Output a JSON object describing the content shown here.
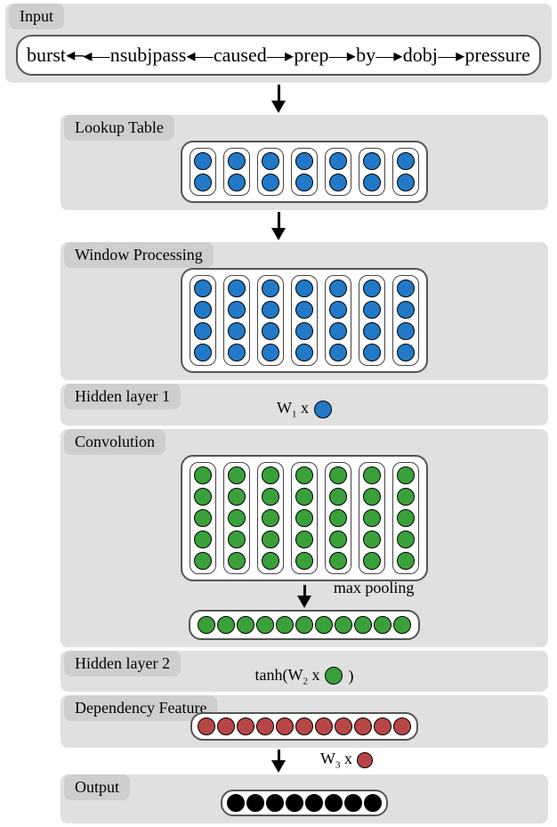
{
  "sections": {
    "input": "Input",
    "lookup": "Lookup Table",
    "window": "Window Processing",
    "hidden1": "Hidden layer 1",
    "conv": "Convolution",
    "hidden2": "Hidden layer 2",
    "depfeat": "Dependency Feature",
    "output": "Output"
  },
  "tokens": [
    "burst",
    "nsubjpass",
    "caused",
    "prep",
    "by",
    "dobj",
    "pressure"
  ],
  "formulas": {
    "hidden1": "W1 x",
    "maxpool": "max pooling",
    "hidden2": "tanh(W2 x",
    "hidden2_close": ")",
    "hidden3": "W3 x"
  },
  "layout": {
    "lookup_cols": 7,
    "lookup_rows": 2,
    "window_cols": 7,
    "window_rows": 4,
    "conv_cols": 7,
    "conv_rows": 5,
    "pooled_len": 11,
    "dep_len": 11,
    "out_len": 8
  },
  "colors": {
    "blue": "#2179c7",
    "green": "#3aa13a",
    "red": "#b84646",
    "black": "#000000",
    "section_bg": "#e0e0e0",
    "label_bg": "#cecece"
  },
  "chart_data": {
    "type": "other",
    "description": "Neural network architecture diagram with layers: Input dependency-path tokens -> Lookup Table (embeddings) -> Window Processing -> Hidden layer 1 (W1 x) -> Convolution -> max pooling -> Hidden layer 2 tanh(W2 x) -> Dependency Feature -> W3 x -> Output",
    "layers": [
      {
        "name": "Input",
        "content": [
          "burst",
          "←nsubjpass←",
          "caused",
          "→prep→",
          "by",
          "→dobj→",
          "pressure"
        ]
      },
      {
        "name": "Lookup Table",
        "shape": [
          2,
          7
        ],
        "color": "blue"
      },
      {
        "name": "Window Processing",
        "shape": [
          4,
          7
        ],
        "color": "blue"
      },
      {
        "name": "Hidden layer 1",
        "op": "W1 x",
        "color": "blue"
      },
      {
        "name": "Convolution",
        "shape": [
          5,
          7
        ],
        "color": "green"
      },
      {
        "name": "Max pooling",
        "length": 11,
        "color": "green"
      },
      {
        "name": "Hidden layer 2",
        "op": "tanh(W2 x)",
        "color": "green"
      },
      {
        "name": "Dependency Feature",
        "length": 11,
        "color": "red"
      },
      {
        "name": "W3 x",
        "color": "red"
      },
      {
        "name": "Output",
        "length": 8,
        "color": "black"
      }
    ]
  }
}
